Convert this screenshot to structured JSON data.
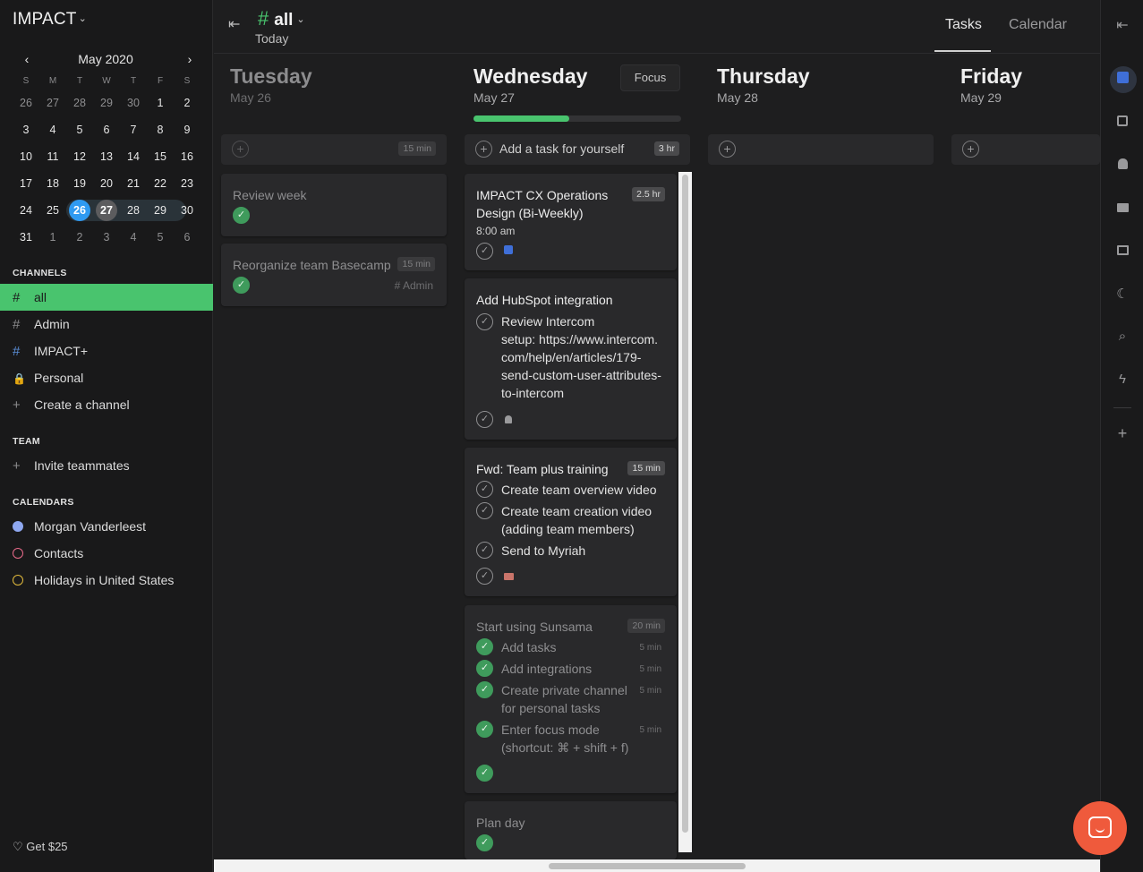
{
  "workspace": {
    "name": "IMPACT"
  },
  "mini_calendar": {
    "month_label": "May 2020",
    "dow": [
      "S",
      "M",
      "T",
      "W",
      "T",
      "F",
      "S"
    ],
    "weeks": [
      [
        "26",
        "27",
        "28",
        "29",
        "30",
        "1",
        "2"
      ],
      [
        "3",
        "4",
        "5",
        "6",
        "7",
        "8",
        "9"
      ],
      [
        "10",
        "11",
        "12",
        "13",
        "14",
        "15",
        "16"
      ],
      [
        "17",
        "18",
        "19",
        "20",
        "21",
        "22",
        "23"
      ],
      [
        "24",
        "25",
        "26",
        "27",
        "28",
        "29",
        "30"
      ],
      [
        "31",
        "1",
        "2",
        "3",
        "4",
        "5",
        "6"
      ]
    ]
  },
  "sidebar": {
    "channels_label": "CHANNELS",
    "channels": [
      {
        "label": "all",
        "icon": "hash-icon",
        "glyph": "#"
      },
      {
        "label": "Admin",
        "icon": "hash-icon",
        "glyph": "#"
      },
      {
        "label": "IMPACT+",
        "icon": "hash-icon",
        "glyph": "#"
      },
      {
        "label": "Personal",
        "icon": "lock-icon",
        "glyph": "🔒"
      },
      {
        "label": "Create a channel",
        "icon": "plus-icon",
        "glyph": "+"
      }
    ],
    "team_label": "TEAM",
    "invite_label": "Invite teammates",
    "calendars_label": "CALENDARS",
    "calendars": [
      {
        "label": "Morgan Vanderleest",
        "color": "#8fa8f0"
      },
      {
        "label": "Contacts",
        "color": "#e86a8a"
      },
      {
        "label": "Holidays in United States",
        "color": "#e0b93c"
      }
    ],
    "get25": "Get $25"
  },
  "header": {
    "channel": "all",
    "subtitle": "Today",
    "tabs": [
      "Tasks",
      "Calendar"
    ]
  },
  "days": [
    {
      "name": "Tuesday",
      "date": "May 26"
    },
    {
      "name": "Wednesday",
      "date": "May 27"
    },
    {
      "name": "Thursday",
      "date": "May 28"
    },
    {
      "name": "Friday",
      "date": "May 29"
    }
  ],
  "wednesday": {
    "focus_label": "Focus",
    "progress": 0.46,
    "add_placeholder": "Add a task for yourself",
    "add_total": "3 hr"
  },
  "tuesday_cards": {
    "add_total": "15 min",
    "review": {
      "title": "Review week"
    },
    "basecamp": {
      "title": "Reorganize team Basecamp",
      "duration": "15 min",
      "tag": "# Admin"
    }
  },
  "cards": {
    "impact": {
      "title_1": "IMPACT CX Operations",
      "title_2": "Design (Bi-Weekly)",
      "duration": "2.5 hr",
      "time": "8:00 am"
    },
    "hubspot": {
      "title": "Add HubSpot integration",
      "sub_lines": [
        "Review Intercom",
        "setup: https://www.intercom.",
        "com/help/en/articles/179-",
        "send-custom-user-attributes-",
        "to-intercom"
      ]
    },
    "training": {
      "title": "Fwd: Team plus training",
      "duration": "15 min",
      "subs": [
        "Create team overview video",
        "Create team creation video",
        "(adding team members)",
        "Send to Myriah"
      ]
    },
    "sunsama": {
      "title": "Start using Sunsama",
      "duration": "20 min",
      "subs": [
        {
          "line1": "Add tasks",
          "min": "5 min"
        },
        {
          "line1": "Add integrations",
          "min": "5 min"
        },
        {
          "line1": "Create private channel",
          "line2": "for personal tasks",
          "min": "5 min"
        },
        {
          "line1": "Enter focus mode",
          "line2": "(shortcut: ⌘ + shift + f)",
          "min": "5 min"
        }
      ]
    },
    "plan": {
      "title": "Plan day"
    }
  },
  "glyphs": {
    "check": "✓",
    "plus": "+",
    "prev": "‹",
    "next": "›",
    "collapse": "⇤",
    "expand": "⇥",
    "caret": "⌄"
  },
  "colors": {
    "accent": "#49c46e",
    "today": "#2f9af1",
    "chat": "#ef5a3c"
  }
}
